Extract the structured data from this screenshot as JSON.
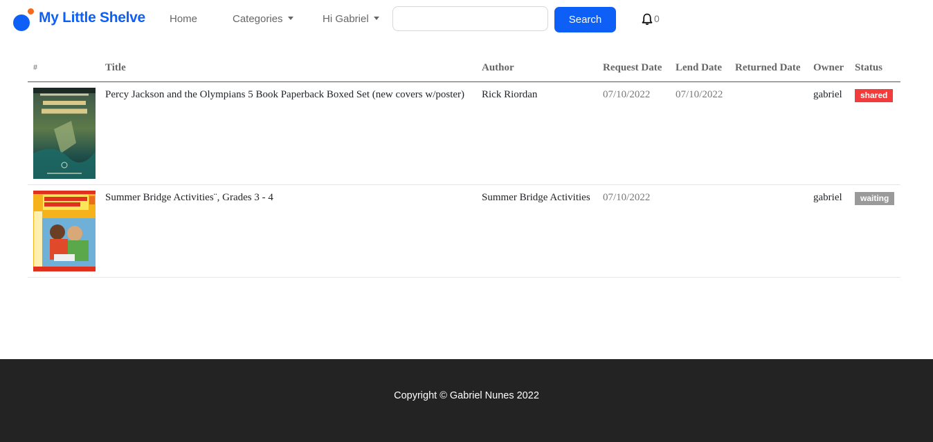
{
  "navbar": {
    "brand": "My Little Shelve",
    "home": "Home",
    "categories": "Categories",
    "user_menu": "Hi Gabriel",
    "search_placeholder": "",
    "search_button": "Search",
    "notification_count": "0",
    "colors": {
      "brand": "#0d5ff5",
      "accent_dot": "#f56a1a"
    }
  },
  "table": {
    "headers": {
      "index": "#",
      "title": "Title",
      "author": "Author",
      "request_date": "Request Date",
      "lend_date": "Lend Date",
      "returned_date": "Returned Date",
      "owner": "Owner",
      "status": "Status"
    },
    "rows": [
      {
        "cover_alt": "Percy Jackson cover",
        "title": "Percy Jackson and the Olympians 5 Book Paperback Boxed Set (new covers w/poster)",
        "author": "Rick Riordan",
        "request_date": "07/10/2022",
        "lend_date": "07/10/2022",
        "returned_date": "",
        "owner": "gabriel",
        "status": "shared",
        "status_color": "#f23b3b"
      },
      {
        "cover_alt": "Summer Bridge Activities cover",
        "title": "Summer Bridge Activities¨, Grades 3 - 4",
        "author": "Summer Bridge Activities",
        "request_date": "07/10/2022",
        "lend_date": "",
        "returned_date": "",
        "owner": "gabriel",
        "status": "waiting",
        "status_color": "#9a9a9a"
      }
    ]
  },
  "footer": {
    "copyright": "Copyright © Gabriel Nunes 2022"
  }
}
